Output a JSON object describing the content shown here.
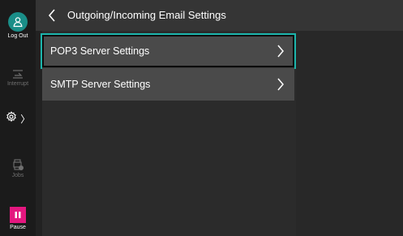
{
  "sidebar": {
    "logout_label": "Log Out",
    "interrupt_label": "Interrupt",
    "settings_chevron": "〉",
    "jobs_label": "Jobs",
    "pause_label": "Pause"
  },
  "header": {
    "title": "Outgoing/Incoming Email Settings"
  },
  "list": {
    "items": [
      {
        "label": "POP3 Server Settings",
        "selected": true
      },
      {
        "label": "SMTP Server Settings",
        "selected": false
      }
    ]
  },
  "colors": {
    "accent": "#1cb5ac",
    "logout": "#1a8e88",
    "pause": "#e4177f",
    "header_bg": "#353535",
    "item_bg": "#4a4a4a"
  },
  "icons": [
    "person-icon",
    "interrupt-icon",
    "gear-icon",
    "jobs-icon",
    "pause-icon",
    "back-chevron-icon",
    "chevron-right-icon"
  ]
}
